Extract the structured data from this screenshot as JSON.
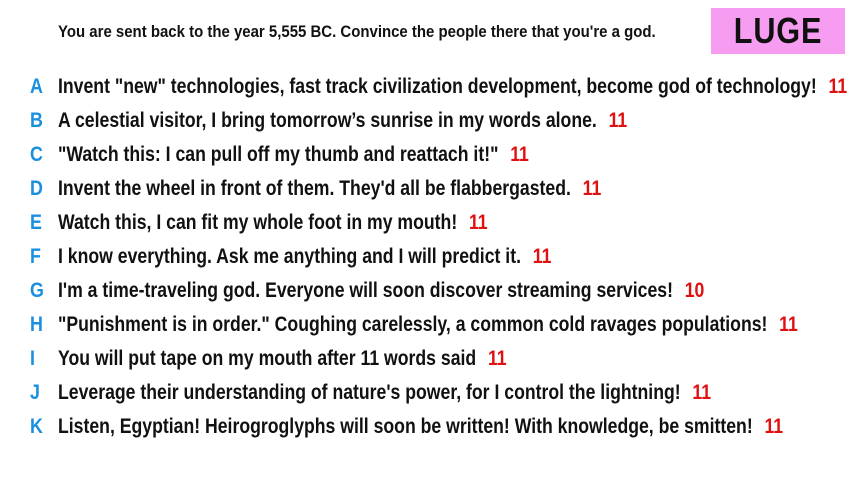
{
  "prompt": "You are sent back to the year 5,555 BC. Convince the people there that you're a god.",
  "badge": {
    "label": "LUGE",
    "color": "#f79df1"
  },
  "colors": {
    "letter": "#1a8fe0",
    "score": "#e01010",
    "text": "#111111"
  },
  "answers": [
    {
      "letter": "A",
      "text": "Invent \"new\" technologies, fast track civilization development, become god of technology!",
      "score": "11"
    },
    {
      "letter": "B",
      "text": "A celestial visitor, I bring tomorrow’s sunrise in my words alone.",
      "score": "11"
    },
    {
      "letter": "C",
      "text": "\"Watch this: I can pull off my thumb and reattach it!\"",
      "score": "11"
    },
    {
      "letter": "D",
      "text": "Invent the wheel in front of them. They'd all be flabbergasted.",
      "score": "11"
    },
    {
      "letter": "E",
      "text": "Watch this, I can fit my whole foot in my mouth!",
      "score": "11"
    },
    {
      "letter": "F",
      "text": "I know everything. Ask me anything and I will predict it.",
      "score": "11"
    },
    {
      "letter": "G",
      "text": "I'm a time-traveling god. Everyone will soon discover streaming services!",
      "score": "10"
    },
    {
      "letter": "H",
      "text": "\"Punishment is in order.\" Coughing carelessly, a common cold ravages populations!",
      "score": "11"
    },
    {
      "letter": "I",
      "text": "You will put tape on my mouth after 11 words said",
      "score": "11"
    },
    {
      "letter": "J",
      "text": "Leverage their understanding of nature's power, for I control the lightning!",
      "score": "11"
    },
    {
      "letter": "K",
      "text": "Listen, Egyptian! Heirogroglyphs will soon be written! With knowledge, be smitten!",
      "score": "11"
    }
  ]
}
